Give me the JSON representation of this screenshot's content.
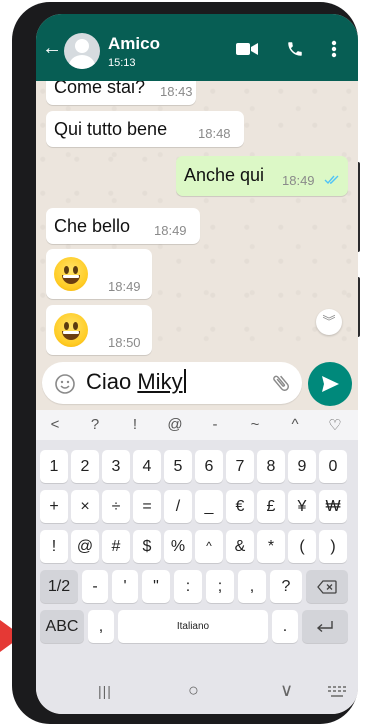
{
  "header": {
    "title": "Amico",
    "subtitle": "15:13",
    "icons": [
      "back-arrow-icon",
      "video-call-icon",
      "phone-icon",
      "more-vert-icon"
    ],
    "color": "#075e54"
  },
  "messages": [
    {
      "direction": "in",
      "text": "Come stai?",
      "time": "18:43"
    },
    {
      "direction": "in",
      "text": "Qui tutto bene",
      "time": "18:48"
    },
    {
      "direction": "out",
      "text": "Anche qui",
      "time": "18:49",
      "status": "read"
    },
    {
      "direction": "in",
      "text": "Che bello",
      "time": "18:49"
    },
    {
      "direction": "in",
      "text": "",
      "emoji": "grinning-face",
      "time": "18:49"
    },
    {
      "direction": "in",
      "text": "",
      "emoji": "grinning-face",
      "time": "18:50"
    }
  ],
  "composer": {
    "text_plain": "Ciao ",
    "text_underlined": "Miky",
    "send_color": "#00897b"
  },
  "keyboard": {
    "strip": [
      "<",
      "?",
      "!",
      "@",
      "-",
      "~",
      "^",
      "♡"
    ],
    "row1": [
      "1",
      "2",
      "3",
      "4",
      "5",
      "6",
      "7",
      "8",
      "9",
      "0"
    ],
    "row2": [
      "+",
      "×",
      "÷",
      "=",
      "/",
      "_",
      "€",
      "£",
      "¥",
      "₩"
    ],
    "row3": [
      "!",
      "@",
      "#",
      "$",
      "%",
      "^",
      "&",
      "*",
      "(",
      ")"
    ],
    "row4": [
      "1/2",
      "-",
      "'",
      "\"",
      ":",
      ";",
      ",",
      "?"
    ],
    "row5": {
      "abc": "ABC",
      "comma": ",",
      "space": "Italiano",
      "period": "."
    }
  },
  "navbar": {
    "recent": "|||",
    "home": "○",
    "back": "∨"
  }
}
